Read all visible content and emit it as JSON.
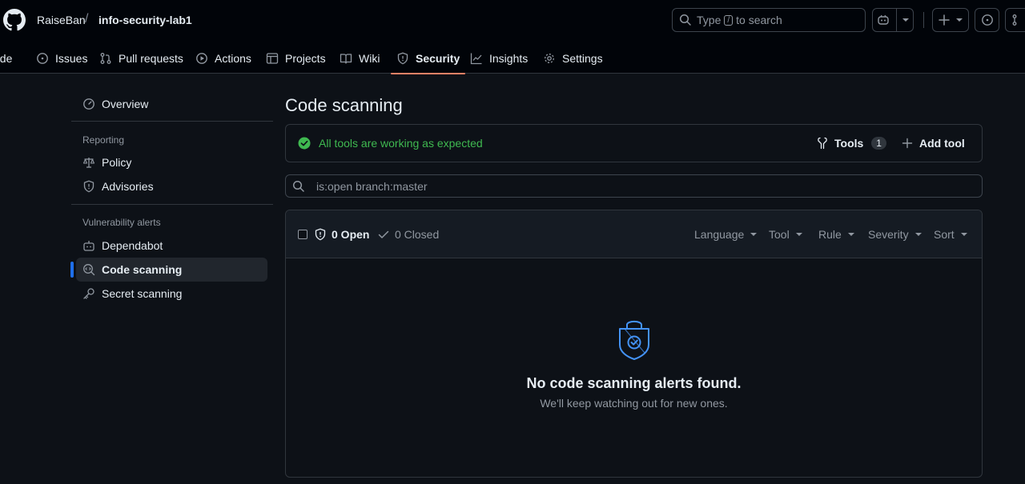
{
  "header": {
    "owner": "RaiseBan",
    "separator": "/",
    "repo": "info-security-lab1",
    "search_prefix": "Type",
    "search_key": "/",
    "search_suffix": "to search"
  },
  "nav": {
    "tabs": [
      {
        "label": "ode",
        "icon": "code-icon"
      },
      {
        "label": "Issues",
        "icon": "issue-icon"
      },
      {
        "label": "Pull requests",
        "icon": "pull-request-icon"
      },
      {
        "label": "Actions",
        "icon": "play-icon"
      },
      {
        "label": "Projects",
        "icon": "table-icon"
      },
      {
        "label": "Wiki",
        "icon": "book-icon"
      },
      {
        "label": "Security",
        "icon": "shield-icon",
        "active": true
      },
      {
        "label": "Insights",
        "icon": "graph-icon"
      },
      {
        "label": "Settings",
        "icon": "gear-icon"
      }
    ]
  },
  "sidebar": {
    "overview": "Overview",
    "reporting_heading": "Reporting",
    "policy": "Policy",
    "advisories": "Advisories",
    "vuln_heading": "Vulnerability alerts",
    "dependabot": "Dependabot",
    "code_scanning": "Code scanning",
    "secret_scanning": "Secret scanning"
  },
  "main": {
    "title": "Code scanning",
    "status_text": "All tools are working as expected",
    "tools_label": "Tools",
    "tools_count": "1",
    "add_tool_label": "Add tool",
    "filter_value": "is:open branch:master",
    "open_label": "0 Open",
    "closed_label": "0 Closed",
    "dropdowns": [
      "Language",
      "Tool",
      "Rule",
      "Severity",
      "Sort"
    ],
    "empty_title": "No code scanning alerts found.",
    "empty_subtitle": "We'll keep watching out for new ones."
  },
  "colors": {
    "accent_blue": "#1f6feb",
    "success_green": "#3fb950",
    "tab_underline": "#f78166",
    "background": "#0d1117"
  }
}
